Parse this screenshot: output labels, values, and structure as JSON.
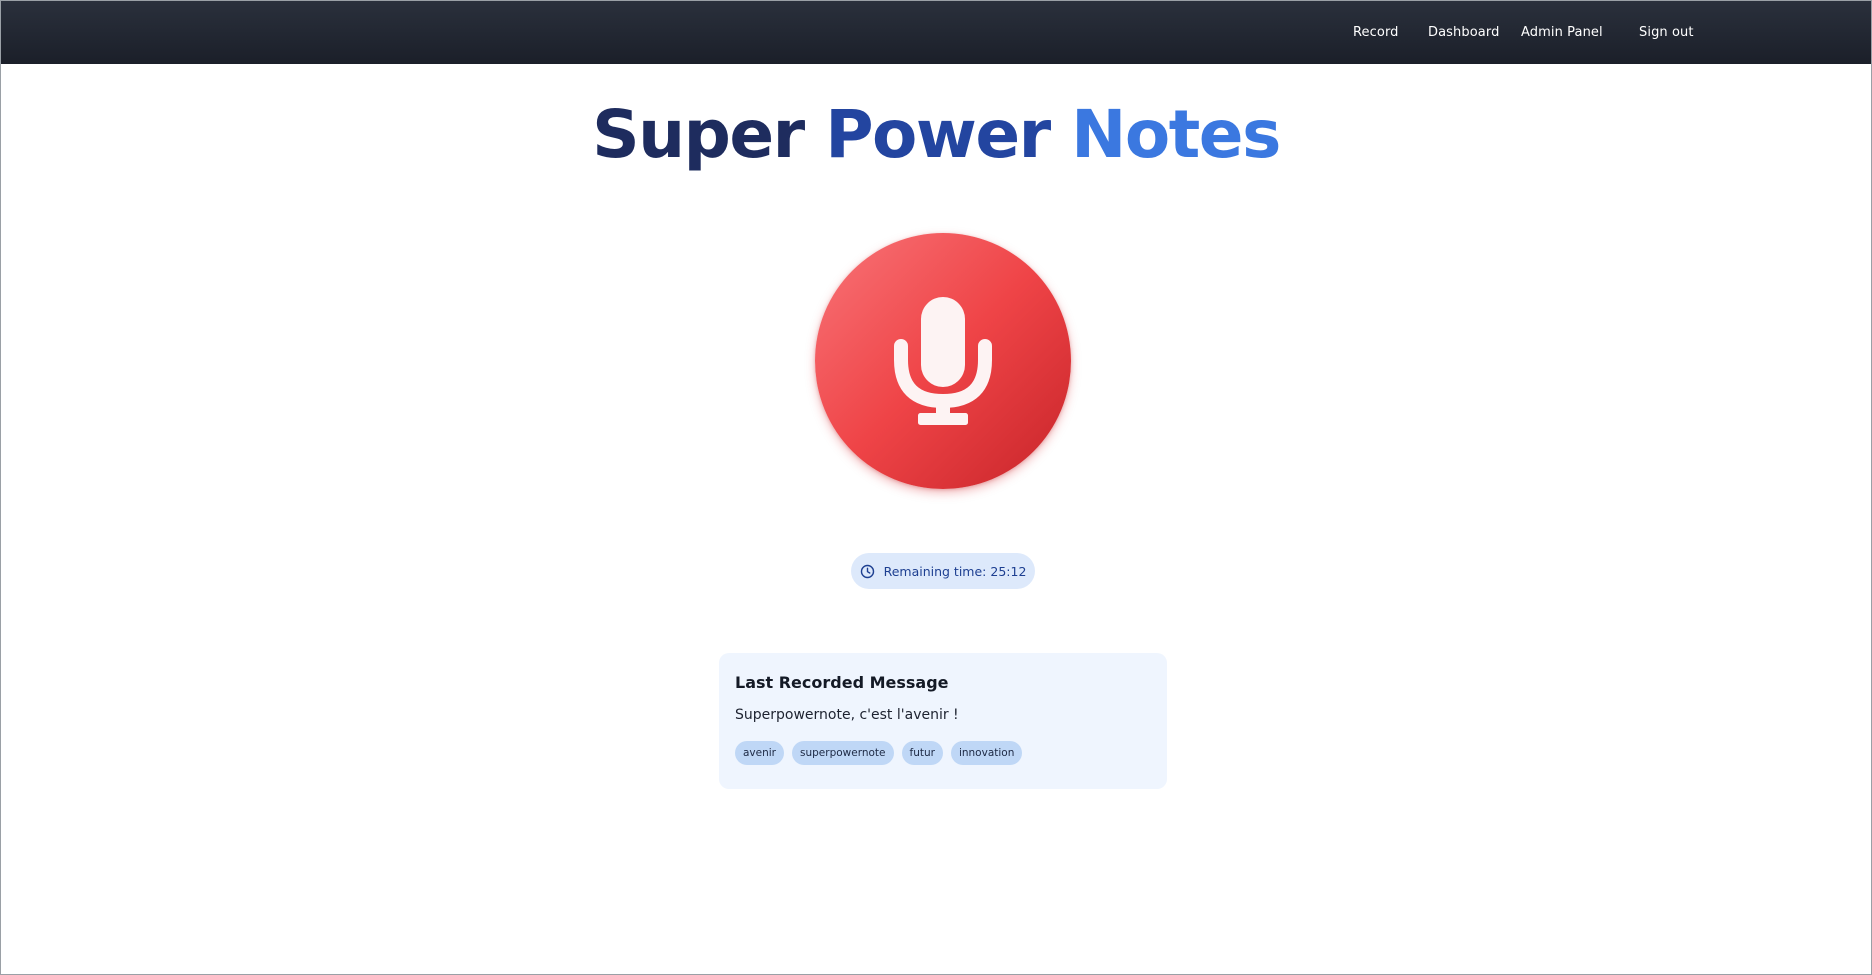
{
  "nav": {
    "items": [
      "Record",
      "Dashboard",
      "Admin Panel",
      "Sign out"
    ]
  },
  "title": {
    "word1": "Super",
    "word2": "Power",
    "word3": "Notes"
  },
  "record_button": {
    "icon": "microphone-icon",
    "color": "#ef4447"
  },
  "timer": {
    "icon": "clock-icon",
    "label": "Remaining time:",
    "value": "25:12"
  },
  "last_message": {
    "heading": "Last Recorded Message",
    "text": "Superpowernote, c'est l'avenir !",
    "tags": [
      "avenir",
      "superpowernote",
      "futur",
      "innovation"
    ]
  },
  "colors": {
    "nav_background": "#1f2430",
    "title_dark": "#1e2c5e",
    "title_mid": "#2345a0",
    "title_light": "#3b78e0",
    "card_background": "#eff5fe",
    "tag_background": "#bfd7f6",
    "timer_background": "#dde9fb"
  }
}
